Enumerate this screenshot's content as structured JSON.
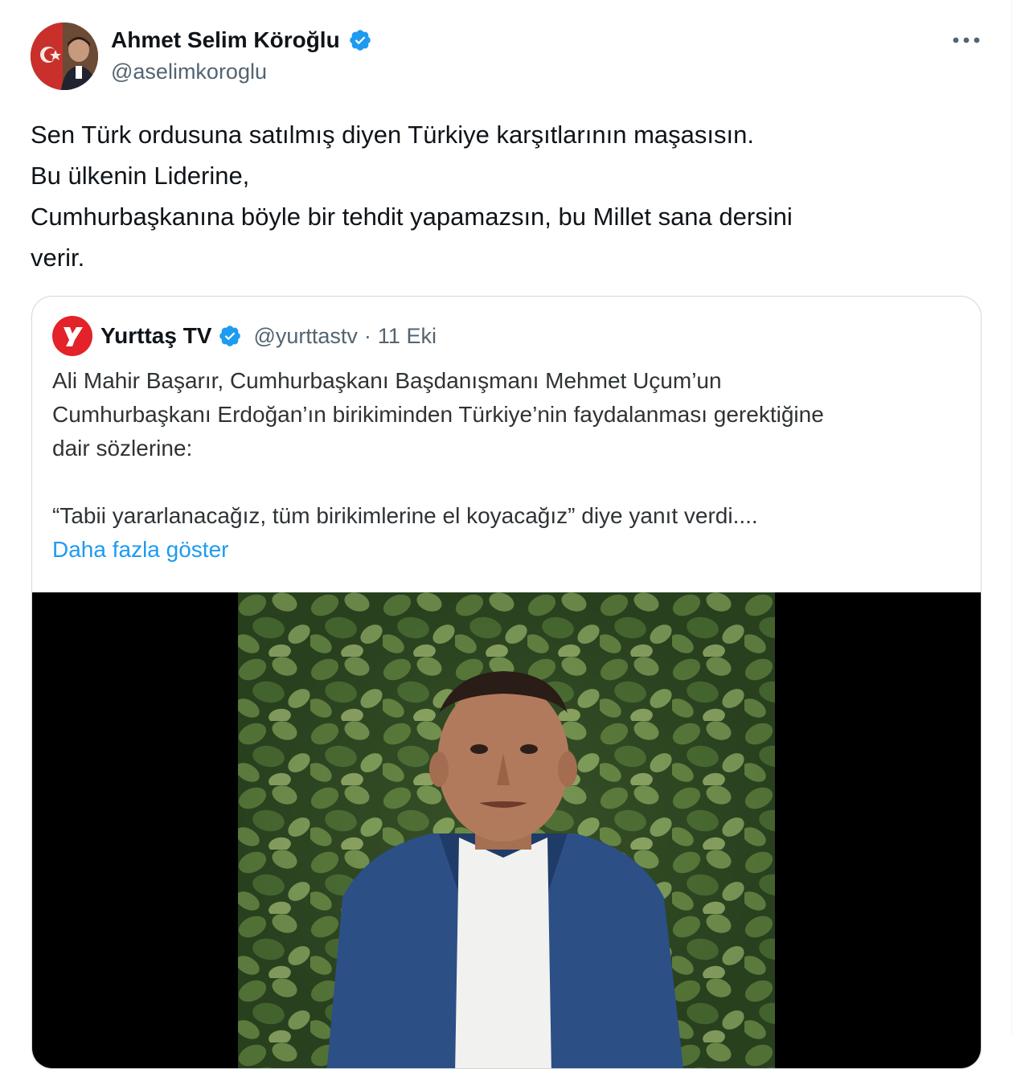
{
  "author": {
    "display_name": "Ahmet Selim Köroğlu",
    "handle": "@aselimkoroglu",
    "verified_icon": "verified-badge-icon"
  },
  "tweet": {
    "lines": [
      "Sen Türk ordusuna satılmış diyen Türkiye karşıtlarının maşasısın.",
      "Bu ülkenin Liderine,",
      "Cumhurbaşkanına böyle bir tehdit yapamazsın, bu Millet sana dersini",
      "verir."
    ]
  },
  "quote": {
    "display_name": "Yurttaş TV",
    "handle": "@yurttastv",
    "separator": "·",
    "date": "11 Eki",
    "lines": [
      "Ali Mahir Başarır, Cumhurbaşkanı Başdanışmanı Mehmet Uçum’un",
      "Cumhurbaşkanı Erdoğan’ın birikiminden Türkiye’nin faydalanması gerektiğine",
      "dair sözlerine:",
      "“Tabii yararlanacağız, tüm birikimlerine el koyacağız” diye yanıt verdi...."
    ],
    "show_more": "Daha fazla göster"
  },
  "colors": {
    "verified": "#1d9bf0",
    "link": "#1d9bf0",
    "secondary_text": "#536471",
    "border": "#cfd9de",
    "yurttas_red": "#e3222a"
  }
}
